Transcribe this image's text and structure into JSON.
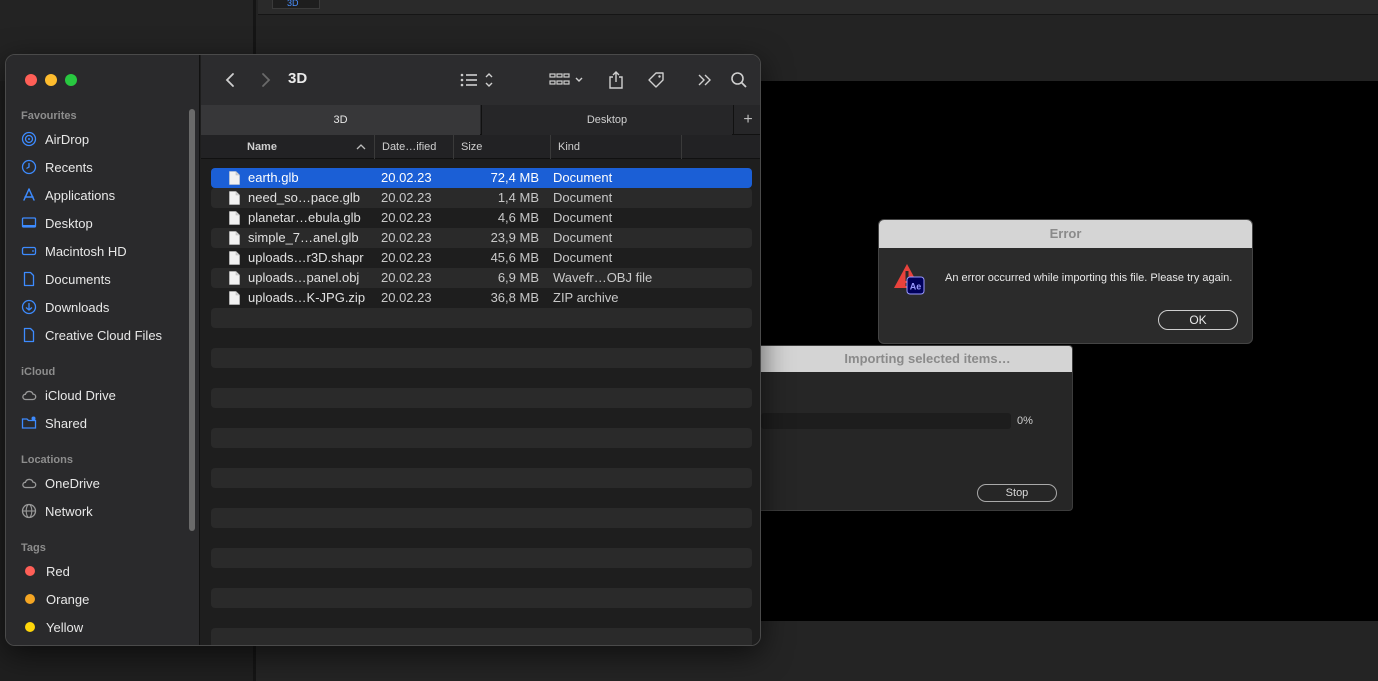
{
  "background": {
    "tab_label": "3D"
  },
  "finder": {
    "title": "3D",
    "tabs": [
      "3D",
      "Desktop"
    ],
    "tab_add": "+",
    "columns": {
      "name": "Name",
      "date": "Date…ified",
      "size": "Size",
      "kind": "Kind"
    },
    "sidebar": {
      "favourites_label": "Favourites",
      "favourites": [
        {
          "label": "AirDrop",
          "icon": "airdrop-icon"
        },
        {
          "label": "Recents",
          "icon": "clock-icon"
        },
        {
          "label": "Applications",
          "icon": "applications-icon"
        },
        {
          "label": "Desktop",
          "icon": "desktop-icon"
        },
        {
          "label": "Macintosh HD",
          "icon": "harddrive-icon"
        },
        {
          "label": "Documents",
          "icon": "document-icon"
        },
        {
          "label": "Downloads",
          "icon": "download-icon"
        },
        {
          "label": "Creative Cloud Files",
          "icon": "document-icon"
        }
      ],
      "icloud_label": "iCloud",
      "icloud": [
        {
          "label": "iCloud Drive",
          "icon": "cloud-icon"
        },
        {
          "label": "Shared",
          "icon": "shared-folder-icon"
        }
      ],
      "locations_label": "Locations",
      "locations": [
        {
          "label": "OneDrive",
          "icon": "cloud-icon"
        },
        {
          "label": "Network",
          "icon": "globe-icon"
        }
      ],
      "tags_label": "Tags",
      "tags": [
        {
          "label": "Red",
          "color": "#ff5f57"
        },
        {
          "label": "Orange",
          "color": "#f5a623"
        },
        {
          "label": "Yellow",
          "color": "#ffd60a"
        }
      ]
    },
    "files": [
      {
        "name": "earth.glb",
        "date": "20.02.23",
        "size": "72,4 MB",
        "kind": "Document",
        "selected": true
      },
      {
        "name": "need_so…pace.glb",
        "date": "20.02.23",
        "size": "1,4 MB",
        "kind": "Document"
      },
      {
        "name": "planetar…ebula.glb",
        "date": "20.02.23",
        "size": "4,6 MB",
        "kind": "Document"
      },
      {
        "name": "simple_7…anel.glb",
        "date": "20.02.23",
        "size": "23,9 MB",
        "kind": "Document"
      },
      {
        "name": "uploads…r3D.shapr",
        "date": "20.02.23",
        "size": "45,6 MB",
        "kind": "Document"
      },
      {
        "name": "uploads…panel.obj",
        "date": "20.02.23",
        "size": "6,9 MB",
        "kind": "Wavefr…OBJ file"
      },
      {
        "name": "uploads…K-JPG.zip",
        "date": "20.02.23",
        "size": "36,8 MB",
        "kind": "ZIP archive"
      }
    ],
    "accent": "#1b5fd6"
  },
  "progress_dialog": {
    "title": "Importing selected items…",
    "percent_label": "0%",
    "progress": 0,
    "stop_label": "Stop"
  },
  "error_dialog": {
    "title": "Error",
    "icon": "ae-warning-icon",
    "icon_badge": "Ae",
    "message": "An error occurred while importing this file. Please try again.",
    "ok_label": "OK"
  }
}
